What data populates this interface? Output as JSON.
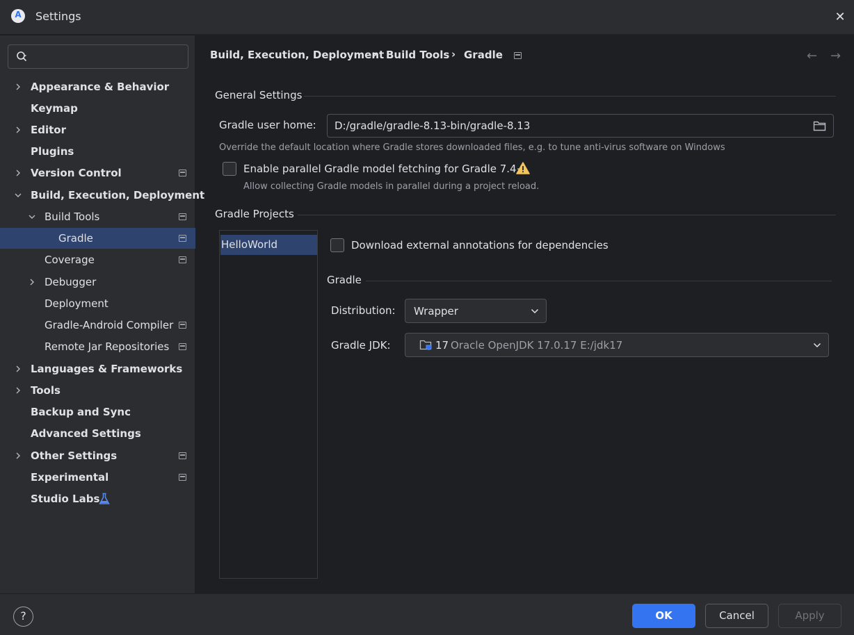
{
  "window": {
    "title": "Settings",
    "close_glyph": "✕"
  },
  "sidebar": {
    "search": {
      "placeholder": "",
      "value": ""
    },
    "items": [
      {
        "label": "Appearance & Behavior",
        "expandable": true,
        "expanded": false,
        "level": 0
      },
      {
        "label": "Keymap",
        "expandable": false,
        "level": 0
      },
      {
        "label": "Editor",
        "expandable": true,
        "expanded": false,
        "level": 0
      },
      {
        "label": "Plugins",
        "expandable": false,
        "level": 0
      },
      {
        "label": "Version Control",
        "expandable": true,
        "expanded": false,
        "level": 0,
        "project_icon": true
      },
      {
        "label": "Build, Execution, Deployment",
        "expandable": true,
        "expanded": true,
        "level": 0
      },
      {
        "label": "Build Tools",
        "expandable": true,
        "expanded": true,
        "level": 1,
        "project_icon": true
      },
      {
        "label": "Gradle",
        "expandable": false,
        "level": 2,
        "selected": true,
        "project_icon": true
      },
      {
        "label": "Coverage",
        "expandable": false,
        "level": 1,
        "project_icon": true
      },
      {
        "label": "Debugger",
        "expandable": true,
        "expanded": false,
        "level": 1
      },
      {
        "label": "Deployment",
        "expandable": false,
        "level": 1
      },
      {
        "label": "Gradle-Android Compiler",
        "expandable": false,
        "level": 1,
        "project_icon": true
      },
      {
        "label": "Remote Jar Repositories",
        "expandable": false,
        "level": 1,
        "project_icon": true
      },
      {
        "label": "Languages & Frameworks",
        "expandable": true,
        "expanded": false,
        "level": 0
      },
      {
        "label": "Tools",
        "expandable": true,
        "expanded": false,
        "level": 0
      },
      {
        "label": "Backup and Sync",
        "expandable": false,
        "level": 0
      },
      {
        "label": "Advanced Settings",
        "expandable": false,
        "level": 0
      },
      {
        "label": "Other Settings",
        "expandable": true,
        "expanded": false,
        "level": 0,
        "project_icon": true
      },
      {
        "label": "Experimental",
        "expandable": false,
        "level": 0,
        "project_icon": true
      },
      {
        "label": "Studio Labs",
        "expandable": false,
        "level": 0,
        "icon": "flask-icon"
      }
    ]
  },
  "breadcrumb": {
    "items": [
      "Build, Execution, Deployment",
      "Build Tools",
      "Gradle"
    ],
    "separator": "›"
  },
  "nav": {
    "back": "←",
    "forward": "→"
  },
  "general": {
    "title": "General Settings",
    "user_home_label": "Gradle user home:",
    "user_home_value": "D:/gradle/gradle-8.13-bin/gradle-8.13",
    "user_home_hint": "Override the default location where Gradle stores downloaded files, e.g. to tune anti-virus software on Windows",
    "parallel_label": "Enable parallel Gradle model fetching for Gradle 7.4+",
    "parallel_checked": false,
    "parallel_hint": "Allow collecting Gradle models in parallel during a project reload."
  },
  "projects": {
    "title": "Gradle Projects",
    "list": [
      "HelloWorld"
    ],
    "download_annotations_label": "Download external annotations for dependencies",
    "download_annotations_checked": false,
    "gradle_section_title": "Gradle",
    "distribution_label": "Distribution:",
    "distribution_value": "Wrapper",
    "jdk_label": "Gradle JDK:",
    "jdk_version": "17",
    "jdk_detail": "Oracle OpenJDK 17.0.17 E:/jdk17"
  },
  "footer": {
    "help": "?",
    "ok": "OK",
    "cancel": "Cancel",
    "apply": "Apply"
  },
  "colors": {
    "accent": "#3574f0",
    "selection": "#2e436e",
    "warning": "#f2c55c",
    "background": "#1e1f22",
    "panel": "#2b2d30"
  }
}
